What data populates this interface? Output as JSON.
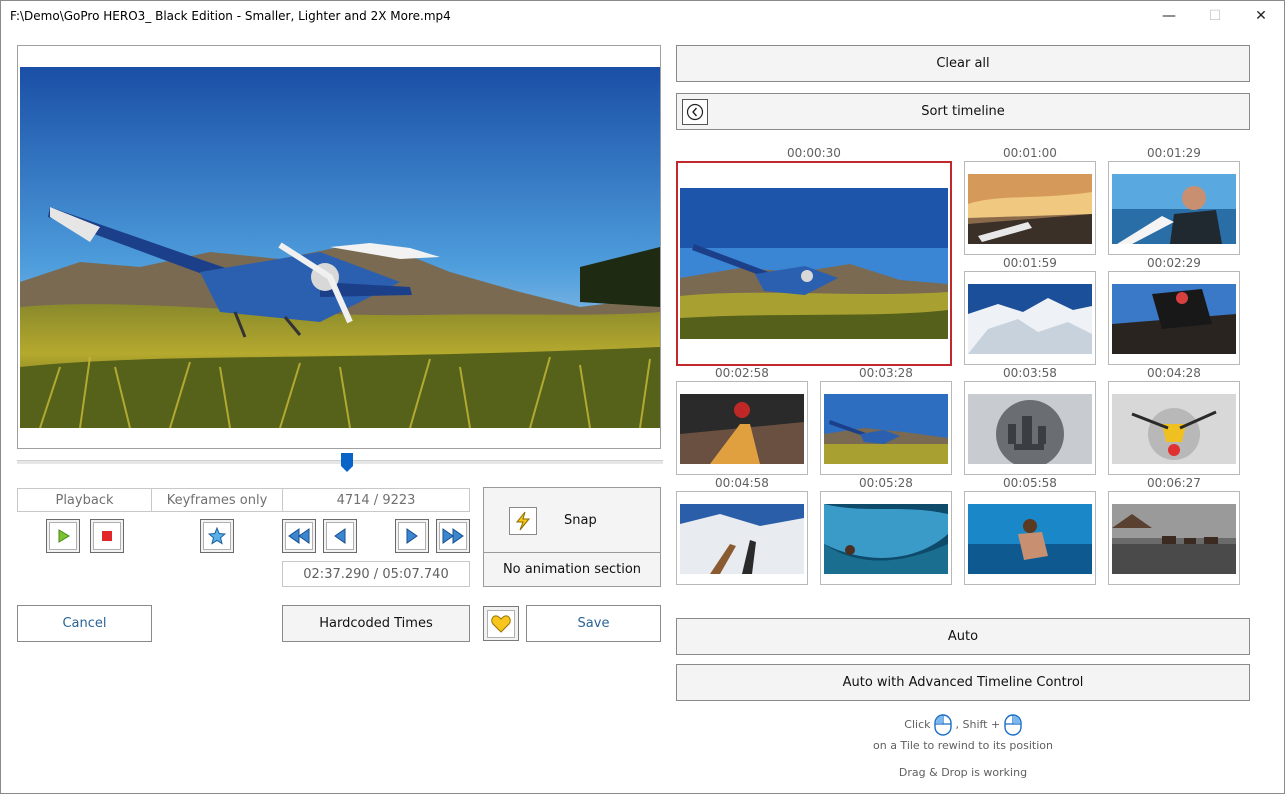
{
  "window": {
    "title": "F:\\Demo\\GoPro HERO3_ Black Edition - Smaller, Lighter and 2X More.mp4",
    "minimize_glyph": "—",
    "maximize_glyph": "☐",
    "close_glyph": "✕"
  },
  "player": {
    "preview_image": "airplane-on-grass-mountains",
    "slider_position_fraction": 0.511,
    "status": {
      "mode_playback": "Playback",
      "mode_keyframes": "Keyframes only",
      "frame_counter": "4714 / 9223"
    },
    "time_position": "02:37.290 / 05:07.740",
    "icons": {
      "play": "play-icon",
      "stop": "stop-icon",
      "keyframe": "star-icon",
      "rewind_fast": "fast-rewind-icon",
      "step_back": "step-back-icon",
      "step_forward": "step-forward-icon",
      "forward_fast": "fast-forward-icon"
    }
  },
  "snap": {
    "label": "Snap",
    "icon": "lightning-icon",
    "no_animation_label": "No animation section"
  },
  "actions": {
    "cancel": "Cancel",
    "hardcoded_times": "Hardcoded Times",
    "favorite_icon": "heart-icon",
    "save": "Save"
  },
  "timeline": {
    "clear_all": "Clear all",
    "sort_timeline": "Sort timeline",
    "sort_icon": "clock-back-icon",
    "selected_tile_color": "#c0282d",
    "tiles": [
      {
        "time": "00:00:30",
        "scene": "airplane-grass",
        "selected": true
      },
      {
        "time": "00:01:00",
        "scene": "sunset-board"
      },
      {
        "time": "00:01:29",
        "scene": "surfer-selfie"
      },
      {
        "time": "00:01:59",
        "scene": "snowy-mountains"
      },
      {
        "time": "00:02:29",
        "scene": "mountain-biker"
      },
      {
        "time": "00:02:58",
        "scene": "downhill-road"
      },
      {
        "time": "00:03:28",
        "scene": "airplane-grass-small"
      },
      {
        "time": "00:03:58",
        "scene": "city-aerial"
      },
      {
        "time": "00:04:28",
        "scene": "skydiver-clouds"
      },
      {
        "time": "00:04:58",
        "scene": "ski-slope"
      },
      {
        "time": "00:05:28",
        "scene": "wave-barrel"
      },
      {
        "time": "00:05:58",
        "scene": "underwater-surfer"
      },
      {
        "time": "00:06:27",
        "scene": "overwater-bungalows"
      }
    ],
    "auto": "Auto",
    "auto_advanced": "Auto with Advanced Timeline Control",
    "hint_click": "Click",
    "hint_shift": ", Shift +",
    "hint_tile": "on a Tile to rewind to its position",
    "hint_drag": "Drag & Drop is working"
  }
}
